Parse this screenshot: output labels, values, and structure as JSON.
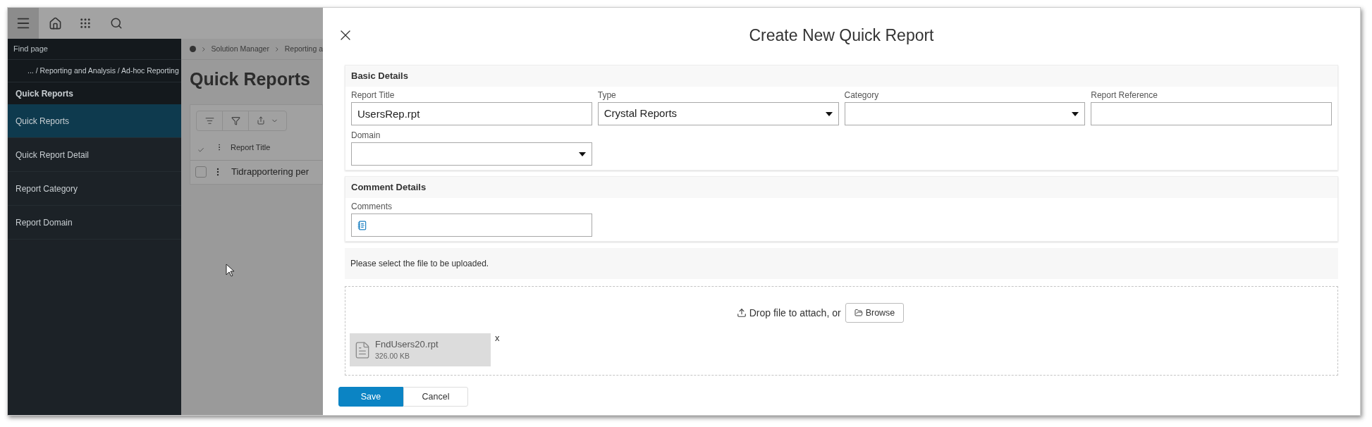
{
  "sidebar": {
    "find_page": "Find page",
    "breadcrumb": "... / Reporting and Analysis / Ad-hoc Reporting",
    "section_title": "Quick Reports",
    "items": [
      {
        "label": "Quick Reports",
        "selected": true
      },
      {
        "label": "Quick Report Detail",
        "selected": false
      },
      {
        "label": "Report Category",
        "selected": false
      },
      {
        "label": "Report Domain",
        "selected": false
      }
    ]
  },
  "page": {
    "breadcrumb": [
      "Solution Manager",
      "Reporting a"
    ],
    "title": "Quick Reports",
    "table": {
      "columns": [
        "Report Title"
      ],
      "rows": [
        {
          "cells": [
            "Tidrapportering per"
          ],
          "checked": false
        }
      ]
    }
  },
  "dialog": {
    "title": "Create New Quick Report",
    "sections": [
      {
        "title": "Basic Details",
        "fields": [
          {
            "label": "Report Title",
            "kind": "text",
            "value": "UsersRep.rpt"
          },
          {
            "label": "Type",
            "kind": "select",
            "value": "Crystal Reports"
          },
          {
            "label": "Category",
            "kind": "select"
          },
          {
            "label": "Report Reference",
            "kind": "text"
          },
          {
            "label": "Domain",
            "kind": "select"
          }
        ]
      },
      {
        "title": "Comment Details",
        "fields": [
          {
            "label": "Comments",
            "kind": "note"
          }
        ]
      }
    ],
    "upload": {
      "prompt": "Please select the file to be uploaded.",
      "drop_text": "Drop file to attach, or",
      "browse": "Browse",
      "files": [
        {
          "name": "FndUsers20.rpt",
          "size": "326.00 KB",
          "remove": "x"
        }
      ]
    },
    "buttons": [
      {
        "label": "Save",
        "kind": "primary"
      },
      {
        "label": "Cancel",
        "kind": "secondary"
      }
    ]
  }
}
